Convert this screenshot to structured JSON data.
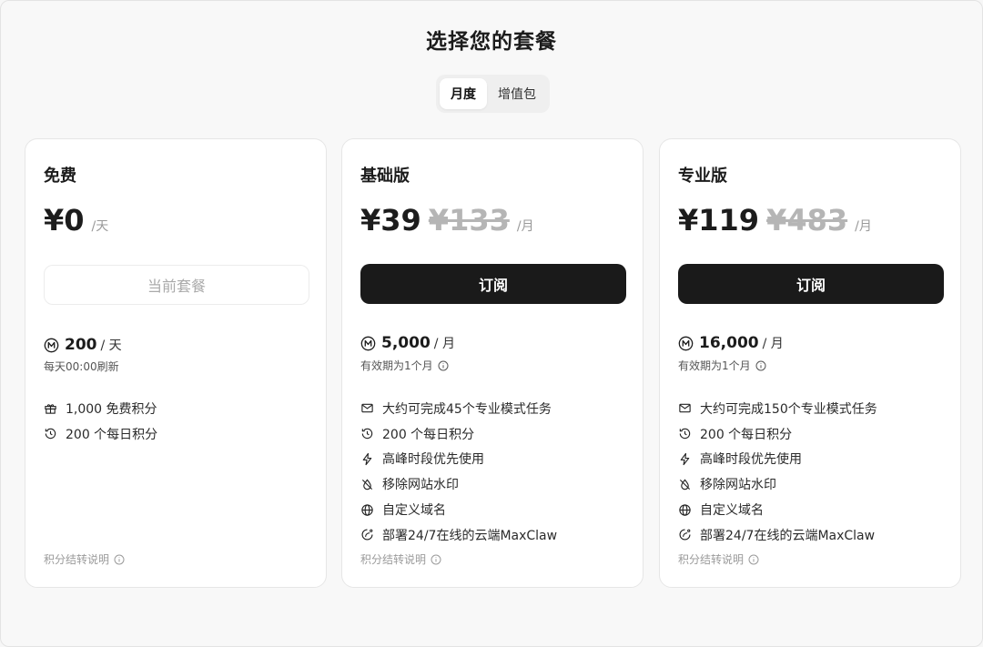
{
  "header": {
    "title": "选择您的套餐"
  },
  "tabs": [
    {
      "label": "月度",
      "active": true
    },
    {
      "label": "增值包",
      "active": false
    }
  ],
  "plans": [
    {
      "name": "免费",
      "price": "¥0",
      "price_unit": "/天",
      "button_label": "当前套餐",
      "credits_amount": "200",
      "credits_unit": "/ 天",
      "credits_note": "每天00:00刷新",
      "features": [
        {
          "icon": "gift-icon",
          "text": "1,000 免费积分"
        },
        {
          "icon": "history-icon",
          "text": "200 个每日积分"
        }
      ],
      "footer_note": "积分结转说明"
    },
    {
      "name": "基础版",
      "price": "¥39",
      "original_price": "¥133",
      "price_unit": "/月",
      "button_label": "订阅",
      "credits_amount": "5,000",
      "credits_unit": "/ 月",
      "credits_note": "有效期为1个月",
      "features": [
        {
          "icon": "mail-icon",
          "text": "大约可完成45个专业模式任务"
        },
        {
          "icon": "history-icon",
          "text": "200 个每日积分"
        },
        {
          "icon": "lightning-icon",
          "text": "高峰时段优先使用"
        },
        {
          "icon": "no-watermark-icon",
          "text": "移除网站水印"
        },
        {
          "icon": "globe-icon",
          "text": "自定义域名"
        },
        {
          "icon": "cloud-agent-icon",
          "text": "部署24/7在线的云端MaxClaw"
        }
      ],
      "footer_note": "积分结转说明"
    },
    {
      "name": "专业版",
      "price": "¥119",
      "original_price": "¥483",
      "price_unit": "/月",
      "button_label": "订阅",
      "credits_amount": "16,000",
      "credits_unit": "/ 月",
      "credits_note": "有效期为1个月",
      "features": [
        {
          "icon": "mail-icon",
          "text": "大约可完成150个专业模式任务"
        },
        {
          "icon": "history-icon",
          "text": "200 个每日积分"
        },
        {
          "icon": "lightning-icon",
          "text": "高峰时段优先使用"
        },
        {
          "icon": "no-watermark-icon",
          "text": "移除网站水印"
        },
        {
          "icon": "globe-icon",
          "text": "自定义域名"
        },
        {
          "icon": "cloud-agent-icon",
          "text": "部署24/7在线的云端MaxClaw"
        }
      ],
      "footer_note": "积分结转说明"
    }
  ],
  "colors": {
    "primary_button": "#1a1a1a",
    "muted_text": "#9a9a9a",
    "strike_price": "#b5b5b5"
  }
}
